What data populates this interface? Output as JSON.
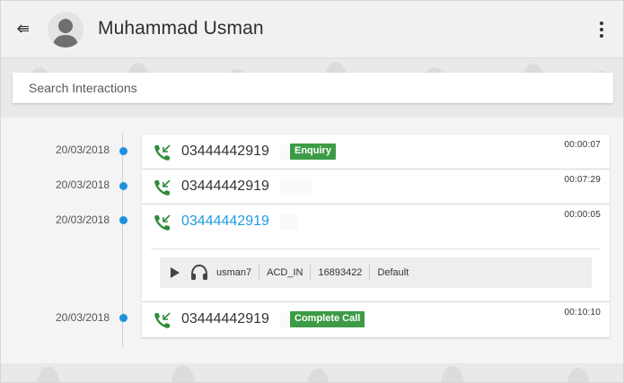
{
  "header": {
    "contact_name": "Muhammad Usman",
    "back_icon": "back-arrow-icon",
    "menu_icon": "more-vertical-icon"
  },
  "search": {
    "placeholder": "Search Interactions"
  },
  "colors": {
    "call_icon": "#2e8b3a",
    "timeline_dot": "#1e90e0",
    "active_number": "#1e9be0",
    "badge": "#3d9b46"
  },
  "interactions": [
    {
      "date": "20/03/2018",
      "number": "03444442919",
      "duration": "00:00:07",
      "badge": "Enquiry",
      "icon": "incoming-call-icon"
    },
    {
      "date": "20/03/2018",
      "number": "03444442919",
      "duration": "00:07:29",
      "badge": "",
      "icon": "incoming-call-icon"
    },
    {
      "date": "20/03/2018",
      "number": "03444442919",
      "duration": "00:00:05",
      "badge": "",
      "icon": "incoming-call-icon",
      "expanded": true,
      "recording": {
        "agent": "usman7",
        "queue": "ACD_IN",
        "call_id": "16893422",
        "disposition": "Default"
      }
    },
    {
      "date": "20/03/2018",
      "number": "03444442919",
      "duration": "00:10:10",
      "badge": "Complete Call",
      "icon": "incoming-call-icon"
    }
  ]
}
